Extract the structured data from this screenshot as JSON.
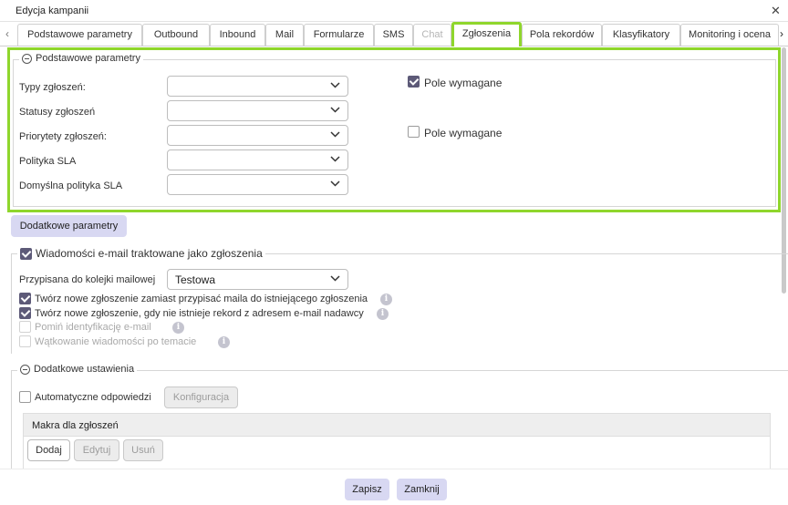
{
  "window": {
    "title": "Edycja kampanii",
    "close_icon": "close-icon"
  },
  "tabs": [
    {
      "label": "Podstawowe parametry",
      "state": "normal"
    },
    {
      "label": "Outbound",
      "state": "normal"
    },
    {
      "label": "Inbound",
      "state": "normal"
    },
    {
      "label": "Mail",
      "state": "normal"
    },
    {
      "label": "Formularze",
      "state": "normal"
    },
    {
      "label": "SMS",
      "state": "normal"
    },
    {
      "label": "Chat",
      "state": "disabled"
    },
    {
      "label": "Zgłoszenia",
      "state": "active"
    },
    {
      "label": "Pola rekordów",
      "state": "normal"
    },
    {
      "label": "Klasyfikatory",
      "state": "normal"
    },
    {
      "label": "Monitoring i ocena",
      "state": "normal"
    }
  ],
  "basic": {
    "legend": "Podstawowe parametry",
    "fields": [
      {
        "label": "Typy zgłoszeń:",
        "value": ""
      },
      {
        "label": "Statusy zgłoszeń",
        "value": ""
      },
      {
        "label": "Priorytety zgłoszeń:",
        "value": ""
      },
      {
        "label": "Polityka SLA",
        "value": ""
      },
      {
        "label": "Domyślna polityka SLA",
        "value": ""
      }
    ],
    "required": [
      {
        "label": "Pole wymagane",
        "checked": true
      },
      {
        "label": "Pole wymagane",
        "checked": false
      }
    ]
  },
  "extra_params_button": "Dodatkowe parametry",
  "email": {
    "legend": "Wiadomości e-mail traktowane jako zgłoszenia",
    "legend_checked": true,
    "queue_label": "Przypisana do kolejki mailowej",
    "queue_value": "Testowa",
    "options": [
      {
        "label": "Twórz nowe zgłoszenie zamiast przypisać maila do istniejącego zgłoszenia",
        "checked": true,
        "disabled": false
      },
      {
        "label": "Twórz nowe zgłoszenie, gdy nie istnieje rekord z adresem e-mail nadawcy",
        "checked": true,
        "disabled": false
      },
      {
        "label": "Pomiń identyfikację e-mail",
        "checked": false,
        "disabled": true
      },
      {
        "label": "Wątkowanie wiadomości po temacie",
        "checked": false,
        "disabled": true
      }
    ]
  },
  "additional": {
    "legend": "Dodatkowe ustawienia",
    "auto_reply_label": "Automatyczne odpowiedzi",
    "auto_reply_checked": false,
    "config_button": "Konfiguracja",
    "macros_header": "Makra dla zgłoszeń",
    "add_button": "Dodaj",
    "edit_button": "Edytuj",
    "delete_button": "Usuń"
  },
  "footer": {
    "save": "Zapisz",
    "close": "Zamknij"
  },
  "colors": {
    "highlight": "#8fd62c",
    "primary_button": "#d8d8f2",
    "checkbox_checked": "#5d5a78"
  }
}
